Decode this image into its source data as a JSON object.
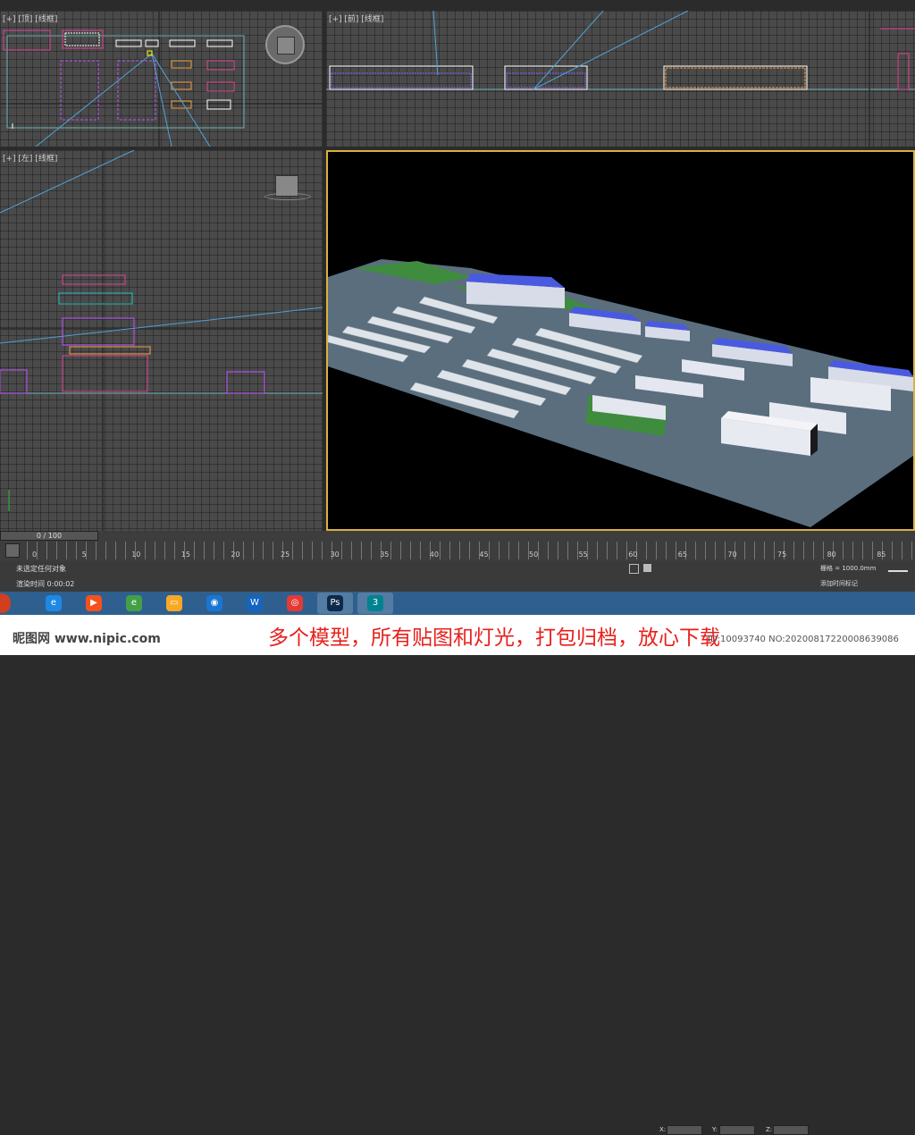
{
  "viewports": {
    "top": {
      "label": "[+] [顶] [线框]"
    },
    "front": {
      "label": "[+] [前] [线框]"
    },
    "left": {
      "label": "[+] [左] [线框]"
    }
  },
  "timeline": {
    "frame_counter": "0 / 100",
    "ticks": [
      "0",
      "5",
      "10",
      "15",
      "20",
      "25",
      "30",
      "35",
      "40",
      "45",
      "50",
      "55",
      "60",
      "65",
      "70",
      "75",
      "80",
      "85"
    ]
  },
  "status": {
    "selection": "未选定任何对象",
    "render_time": "渲染时间 0:00:02",
    "x_label": "X:",
    "y_label": "Y:",
    "z_label": "Z:",
    "grid": "栅格 = 1000.0mm",
    "add_tag": "添加时间标记"
  },
  "taskbar": {
    "apps": [
      {
        "name": "ie-icon",
        "glyph": "e",
        "color": "#1e88e5"
      },
      {
        "name": "media-player-icon",
        "glyph": "▶",
        "color": "#f4511e"
      },
      {
        "name": "360-browser-icon",
        "glyph": "e",
        "color": "#43a047"
      },
      {
        "name": "file-explorer-icon",
        "glyph": "▭",
        "color": "#f9a825"
      },
      {
        "name": "security-icon",
        "glyph": "◉",
        "color": "#1976d2"
      },
      {
        "name": "wps-icon",
        "glyph": "W",
        "color": "#1565c0"
      },
      {
        "name": "chrome-icon",
        "glyph": "◎",
        "color": "#e53935"
      },
      {
        "name": "photoshop-icon",
        "glyph": "Ps",
        "color": "#0d2a4a"
      },
      {
        "name": "3dsmax-icon",
        "glyph": "3",
        "color": "#00838f"
      }
    ]
  },
  "watermark": {
    "logo": "昵图网 www.nipic.com",
    "caption": "多个模型，所有贴图和灯光，打包归档，放心下载",
    "id": "ID:10093740 NO:20200817220008639086"
  }
}
